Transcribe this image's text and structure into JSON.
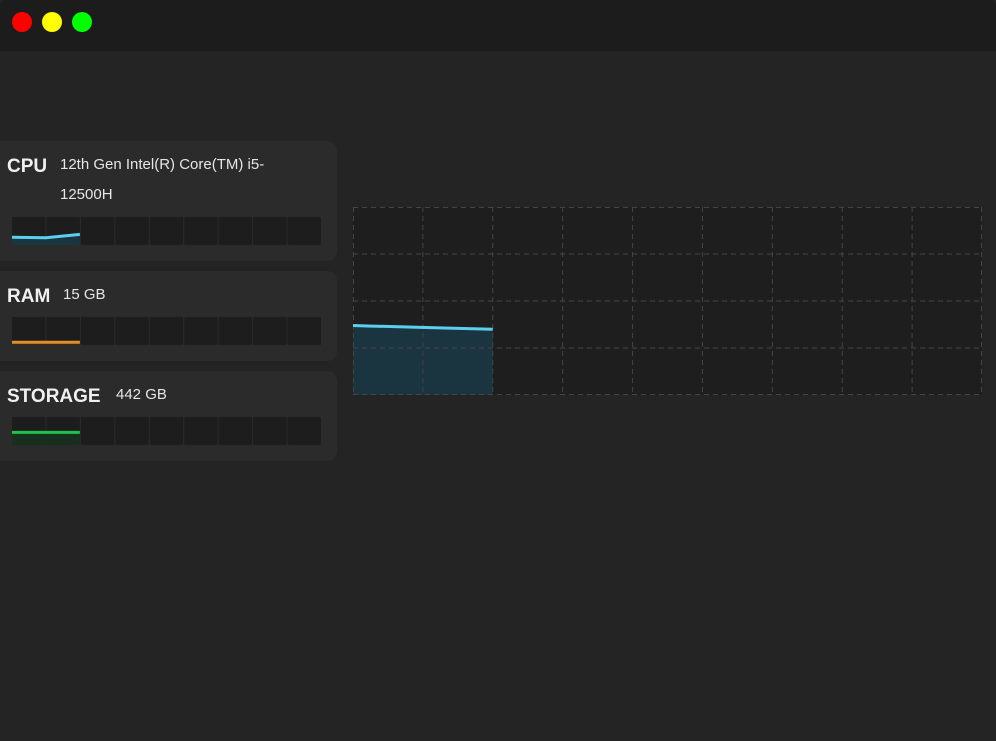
{
  "window": {
    "controls": [
      {
        "name": "close",
        "color": "#ff0000"
      },
      {
        "name": "minimize",
        "color": "#ffff00"
      },
      {
        "name": "maximize",
        "color": "#00ff00"
      }
    ]
  },
  "cards": {
    "cpu": {
      "label": "CPU",
      "detail_line1": "12th Gen Intel(R) Core(TM) i5-",
      "detail_line2": "12500H",
      "color": "#5ccfee",
      "fill": "#1b3a46",
      "usage_series": [
        0.72,
        0.74,
        0.62
      ]
    },
    "ram": {
      "label": "RAM",
      "detail": "15 GB",
      "color": "#e0902a",
      "fill": "#3a2a18",
      "usage_series": [
        0.9,
        0.9,
        0.9
      ]
    },
    "storage": {
      "label": "STORAGE",
      "detail": "442 GB",
      "color": "#22c24a",
      "fill": "#163320",
      "usage_series": [
        0.55,
        0.55,
        0.55
      ]
    }
  },
  "main_chart": {
    "series_color": "#5ccfee",
    "series_fill": "#1b3a46",
    "grid_color": "#454545",
    "grid_cols": 9,
    "grid_rows": 4,
    "values": [
      0.63,
      0.61,
      0.65
    ]
  }
}
